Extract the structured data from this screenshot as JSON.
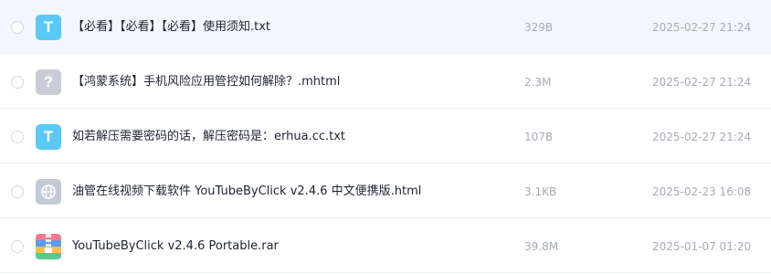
{
  "files": [
    {
      "name": "【必看】【必看】【必看】使用须知.txt",
      "size": "329B",
      "date": "2025-02-27 21:24",
      "icon": "txt-file-icon",
      "icon_glyph": "T",
      "selected": true
    },
    {
      "name": "【鸿蒙系统】手机风险应用管控如何解除？.mhtml",
      "size": "2.3M",
      "date": "2025-02-27 21:24",
      "icon": "unknown-file-icon",
      "icon_glyph": "?",
      "selected": false
    },
    {
      "name": "如若解压需要密码的话，解压密码是：erhua.cc.txt",
      "size": "107B",
      "date": "2025-02-27 21:24",
      "icon": "txt-file-icon",
      "icon_glyph": "T",
      "selected": false
    },
    {
      "name": "油管在线视频下载软件 YouTubeByClick v2.4.6 中文便携版.html",
      "size": "3.1KB",
      "date": "2025-02-23 16:08",
      "icon": "html-file-icon",
      "selected": false
    },
    {
      "name": "YouTubeByClick v2.4.6 Portable.rar",
      "size": "39.8M",
      "date": "2025-01-07 01:20",
      "icon": "rar-file-icon",
      "selected": false
    }
  ],
  "colors": {
    "selected_row_bg": "#f3f6fd",
    "txt_icon_bg": "#5bc8f5",
    "unknown_icon_bg": "#c9ccd6",
    "html_icon_bg": "#c4c9d8",
    "meta_text": "#a6abb5",
    "name_text": "#1e2330"
  }
}
